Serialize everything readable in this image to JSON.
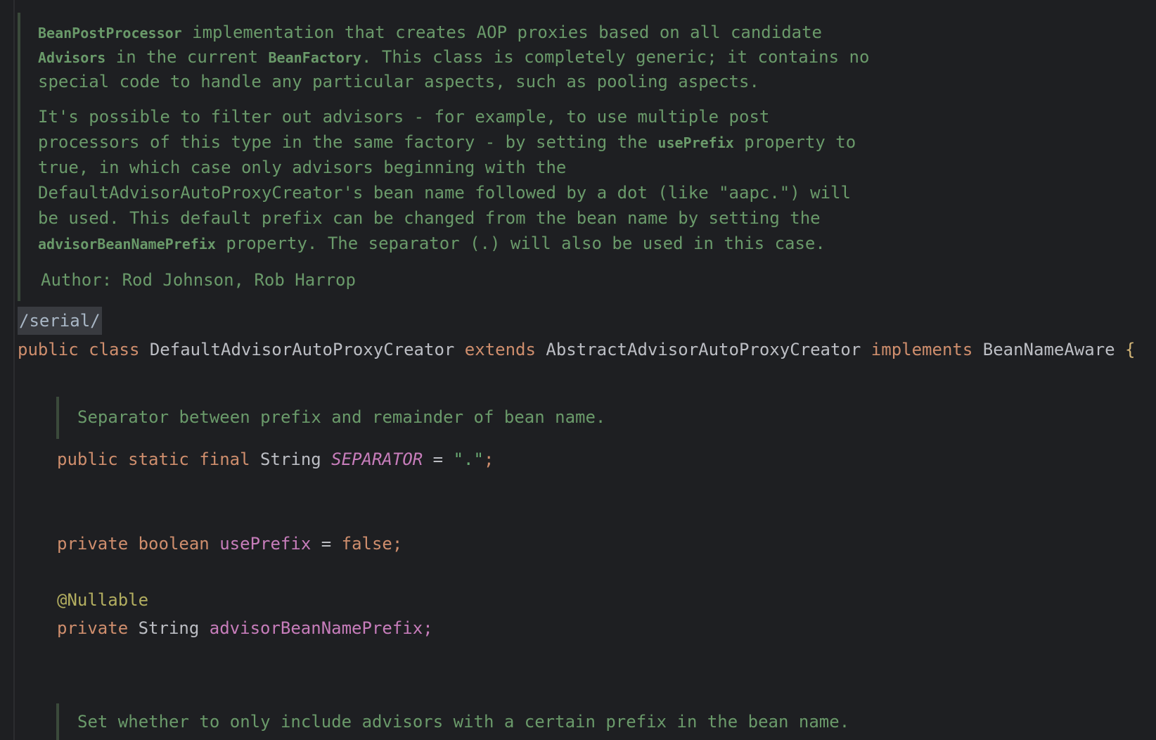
{
  "javadoc_class": {
    "p1": {
      "code1": "BeanPostProcessor",
      "text1": " implementation that creates AOP proxies based on all candidate",
      "code2": "Advisors",
      "text2": " in the current ",
      "code3": "BeanFactory",
      "text3": ". This class is completely generic; it contains no",
      "text4": "special code to handle any particular aspects, such as pooling aspects."
    },
    "p2": {
      "line1": "It's possible to filter out advisors - for example, to use multiple post",
      "line2_pre": "processors of this type in the same factory - by setting the ",
      "line2_code": "usePrefix",
      "line2_post": " property to",
      "line3": "true, in which case only advisors beginning with the",
      "line4": "DefaultAdvisorAutoProxyCreator's bean name followed by a dot (like \"aapc.\") will",
      "line5": "be used. This default prefix can be changed from the bean name by setting the",
      "line6_code": "advisorBeanNamePrefix",
      "line6_post": " property. The separator (.) will also be used in this case."
    },
    "author_label": "Author:",
    "author_value": " Rod Johnson, Rob Harrop"
  },
  "serial_tag": "/serial/",
  "class_decl": {
    "kw_public": "public",
    "kw_class": "class",
    "name": "DefaultAdvisorAutoProxyCreator",
    "kw_extends": "extends",
    "parent": "AbstractAdvisorAutoProxyCreator",
    "kw_implements": "implements",
    "iface": "BeanNameAware",
    "brace": "{"
  },
  "separator_doc": "Separator between prefix and remainder of bean name.",
  "separator_field": {
    "kw_public": "public",
    "kw_static": "static",
    "kw_final": "final",
    "type": "String",
    "name": "SEPARATOR",
    "eq": " = ",
    "value": "\".\"",
    "semi": ";"
  },
  "use_prefix_field": {
    "kw_private": "private",
    "kw_type": "boolean",
    "name": "usePrefix",
    "eq": " = ",
    "value": "false",
    "semi": ";"
  },
  "annotation": "@Nullable",
  "prefix_field": {
    "kw_private": "private",
    "type": "String",
    "name": "advisorBeanNamePrefix",
    "semi": ";"
  },
  "set_prefix_doc": "Set whether to only include advisors with a certain prefix in the bean name.",
  "colors": {
    "background": "#1e1f22",
    "keyword": "#cf8e6d",
    "field": "#c77dbb",
    "doc_comment": "#6a9a6a",
    "annotation": "#b3ae60",
    "brace": "#d5b778"
  }
}
